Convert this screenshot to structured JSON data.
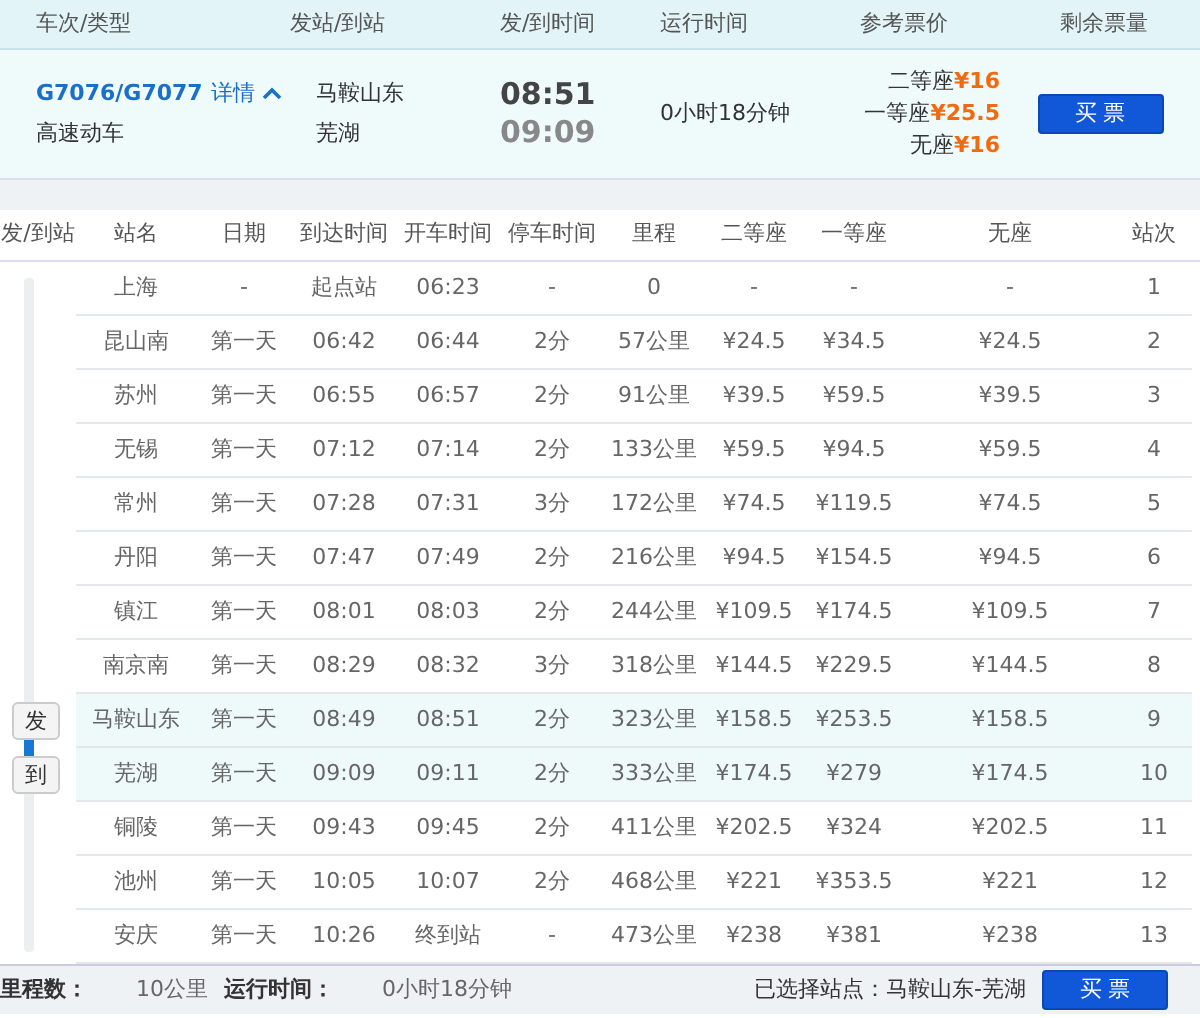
{
  "header": [
    "车次/类型",
    "发站/到站",
    "发/到时间",
    "运行时间",
    "参考票价",
    "剩余票量"
  ],
  "train": {
    "number": "G7076/G7077",
    "details_link": "详情",
    "expanded": true,
    "type": "高速动车",
    "from_station": "马鞍山东",
    "to_station": "芜湖",
    "depart_time": "08:51",
    "arrive_time": "09:09",
    "duration": "0小时18分钟",
    "prices": [
      {
        "seat": "二等座",
        "price": "¥16"
      },
      {
        "seat": "一等座",
        "price": "¥25.5"
      },
      {
        "seat": "无座",
        "price": "¥16"
      }
    ],
    "buy_button": "买 票"
  },
  "stops": {
    "columns": [
      "发/到站",
      "站名",
      "日期",
      "到达时间",
      "开车时间",
      "停车时间",
      "里程",
      "二等座",
      "一等座",
      "无座",
      "站次"
    ],
    "rows": [
      {
        "selected": false,
        "cells": [
          "",
          "上海",
          "-",
          "起点站",
          "06:23",
          "-",
          "0",
          "-",
          "-",
          "-",
          "1"
        ]
      },
      {
        "selected": false,
        "cells": [
          "",
          "昆山南",
          "第一天",
          "06:42",
          "06:44",
          "2分",
          "57公里",
          "¥24.5",
          "¥34.5",
          "¥24.5",
          "2"
        ]
      },
      {
        "selected": false,
        "cells": [
          "",
          "苏州",
          "第一天",
          "06:55",
          "06:57",
          "2分",
          "91公里",
          "¥39.5",
          "¥59.5",
          "¥39.5",
          "3"
        ]
      },
      {
        "selected": false,
        "cells": [
          "",
          "无锡",
          "第一天",
          "07:12",
          "07:14",
          "2分",
          "133公里",
          "¥59.5",
          "¥94.5",
          "¥59.5",
          "4"
        ]
      },
      {
        "selected": false,
        "cells": [
          "",
          "常州",
          "第一天",
          "07:28",
          "07:31",
          "3分",
          "172公里",
          "¥74.5",
          "¥119.5",
          "¥74.5",
          "5"
        ]
      },
      {
        "selected": false,
        "cells": [
          "",
          "丹阳",
          "第一天",
          "07:47",
          "07:49",
          "2分",
          "216公里",
          "¥94.5",
          "¥154.5",
          "¥94.5",
          "6"
        ]
      },
      {
        "selected": false,
        "cells": [
          "",
          "镇江",
          "第一天",
          "08:01",
          "08:03",
          "2分",
          "244公里",
          "¥109.5",
          "¥174.5",
          "¥109.5",
          "7"
        ]
      },
      {
        "selected": false,
        "cells": [
          "",
          "南京南",
          "第一天",
          "08:29",
          "08:32",
          "3分",
          "318公里",
          "¥144.5",
          "¥229.5",
          "¥144.5",
          "8"
        ]
      },
      {
        "selected": true,
        "cells": [
          "发",
          "马鞍山东",
          "第一天",
          "08:49",
          "08:51",
          "2分",
          "323公里",
          "¥158.5",
          "¥253.5",
          "¥158.5",
          "9"
        ]
      },
      {
        "selected": true,
        "cells": [
          "到",
          "芜湖",
          "第一天",
          "09:09",
          "09:11",
          "2分",
          "333公里",
          "¥174.5",
          "¥279",
          "¥174.5",
          "10"
        ]
      },
      {
        "selected": false,
        "cells": [
          "",
          "铜陵",
          "第一天",
          "09:43",
          "09:45",
          "2分",
          "411公里",
          "¥202.5",
          "¥324",
          "¥202.5",
          "11"
        ]
      },
      {
        "selected": false,
        "cells": [
          "",
          "池州",
          "第一天",
          "10:05",
          "10:07",
          "2分",
          "468公里",
          "¥221",
          "¥353.5",
          "¥221",
          "12"
        ]
      },
      {
        "selected": false,
        "cells": [
          "",
          "安庆",
          "第一天",
          "10:26",
          "终到站",
          "-",
          "473公里",
          "¥238",
          "¥381",
          "¥238",
          "13"
        ]
      }
    ]
  },
  "footer": {
    "distance_label": "里程数：",
    "distance": "10公里",
    "duration_label": "运行时间：",
    "duration": "0小时18分钟",
    "selected_label": "已选择站点：马鞍山东-芜湖",
    "buy_button": "买 票"
  }
}
